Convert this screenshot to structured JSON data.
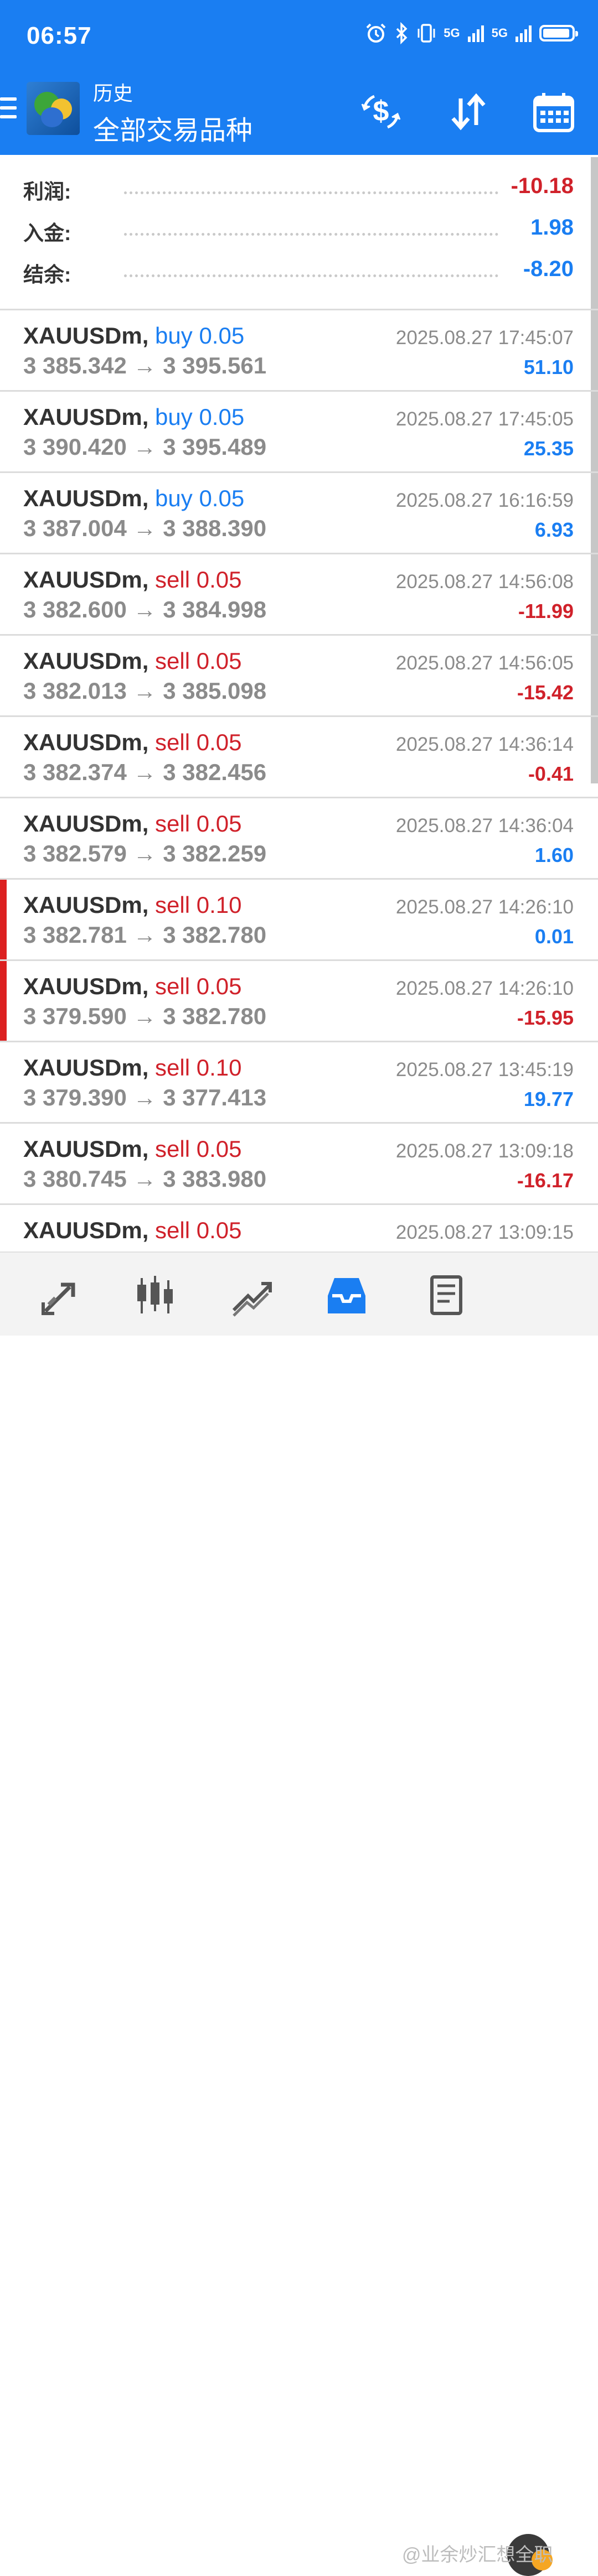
{
  "status_bar": {
    "time": "06:57",
    "signal_label_1": "5G",
    "signal_label_2": "5G",
    "battery_level": 0.9
  },
  "header": {
    "subtitle": "历史",
    "title": "全部交易品种",
    "icons": [
      "menu-icon",
      "app-logo",
      "dollar-refresh-icon",
      "sort-icon",
      "calendar-icon"
    ]
  },
  "summary": {
    "profit_label": "利润:",
    "profit_value": "-10.18",
    "deposit_label": "入金:",
    "deposit_value": "1.98",
    "balance_label": "结余:",
    "balance_value": "-8.20"
  },
  "trades": [
    {
      "symbol": "XAUUSDm,",
      "side": "buy",
      "volume": "0.05",
      "open": "3 385.342",
      "close": "3 395.561",
      "time": "2025.08.27 17:45:07",
      "profit": "51.10",
      "marked": false
    },
    {
      "symbol": "XAUUSDm,",
      "side": "buy",
      "volume": "0.05",
      "open": "3 390.420",
      "close": "3 395.489",
      "time": "2025.08.27 17:45:05",
      "profit": "25.35",
      "marked": false
    },
    {
      "symbol": "XAUUSDm,",
      "side": "buy",
      "volume": "0.05",
      "open": "3 387.004",
      "close": "3 388.390",
      "time": "2025.08.27 16:16:59",
      "profit": "6.93",
      "marked": false
    },
    {
      "symbol": "XAUUSDm,",
      "side": "sell",
      "volume": "0.05",
      "open": "3 382.600",
      "close": "3 384.998",
      "time": "2025.08.27 14:56:08",
      "profit": "-11.99",
      "marked": false
    },
    {
      "symbol": "XAUUSDm,",
      "side": "sell",
      "volume": "0.05",
      "open": "3 382.013",
      "close": "3 385.098",
      "time": "2025.08.27 14:56:05",
      "profit": "-15.42",
      "marked": false
    },
    {
      "symbol": "XAUUSDm,",
      "side": "sell",
      "volume": "0.05",
      "open": "3 382.374",
      "close": "3 382.456",
      "time": "2025.08.27 14:36:14",
      "profit": "-0.41",
      "marked": false
    },
    {
      "symbol": "XAUUSDm,",
      "side": "sell",
      "volume": "0.05",
      "open": "3 382.579",
      "close": "3 382.259",
      "time": "2025.08.27 14:36:04",
      "profit": "1.60",
      "marked": false
    },
    {
      "symbol": "XAUUSDm,",
      "side": "sell",
      "volume": "0.10",
      "open": "3 382.781",
      "close": "3 382.780",
      "time": "2025.08.27 14:26:10",
      "profit": "0.01",
      "marked": true
    },
    {
      "symbol": "XAUUSDm,",
      "side": "sell",
      "volume": "0.05",
      "open": "3 379.590",
      "close": "3 382.780",
      "time": "2025.08.27 14:26:10",
      "profit": "-15.95",
      "marked": true
    },
    {
      "symbol": "XAUUSDm,",
      "side": "sell",
      "volume": "0.10",
      "open": "3 379.390",
      "close": "3 377.413",
      "time": "2025.08.27 13:45:19",
      "profit": "19.77",
      "marked": false
    },
    {
      "symbol": "XAUUSDm,",
      "side": "sell",
      "volume": "0.05",
      "open": "3 380.745",
      "close": "3 383.980",
      "time": "2025.08.27 13:09:18",
      "profit": "-16.17",
      "marked": false
    },
    {
      "symbol": "XAUUSDm,",
      "side": "sell",
      "volume": "0.05",
      "open": "",
      "close": "",
      "time": "2025.08.27 13:09:15",
      "profit": "",
      "marked": false
    }
  ],
  "bottom_nav": {
    "items": [
      "quotes-icon",
      "chart-candles-icon",
      "trade-icon",
      "history-icon",
      "journal-icon",
      "chat-icon"
    ],
    "active": "history-icon",
    "watermark": "@业余炒汇想全职"
  },
  "colors": {
    "accent": "#1a7ef2",
    "negative": "#d0212a",
    "marker": "#dc2020",
    "muted": "#8b8b8b"
  }
}
